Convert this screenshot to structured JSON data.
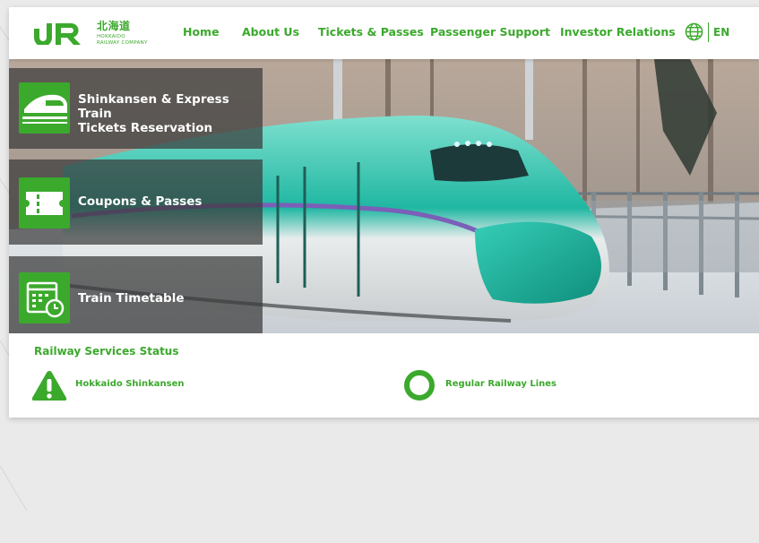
{
  "header": {
    "logo": {
      "kanji": "北海道",
      "subtitle": "HOKKAIDO\nRAILWAY COMPANY"
    },
    "nav": [
      {
        "label": "Home"
      },
      {
        "label": "About Us"
      },
      {
        "label": "Tickets & Passes"
      },
      {
        "label": "Passenger Support"
      },
      {
        "label": "Investor Relations"
      }
    ],
    "language": "EN"
  },
  "hero": {
    "menu": [
      {
        "label": "Shinkansen & Express Train\nTickets Reservation",
        "icon": "shinkansen-train-icon"
      },
      {
        "label": "Coupons & Passes",
        "icon": "ticket-icon"
      },
      {
        "label": "Train Timetable",
        "icon": "calendar-clock-icon"
      }
    ]
  },
  "status": {
    "title": "Railway Services Status",
    "items": [
      {
        "label": "Hokkaido Shinkansen",
        "icon": "warning-icon"
      },
      {
        "label": "Regular Railway Lines",
        "icon": "circle-normal-icon"
      }
    ]
  },
  "colors": {
    "brand_green": "#3ba92c",
    "panel_gray": "#3a3a3a"
  }
}
